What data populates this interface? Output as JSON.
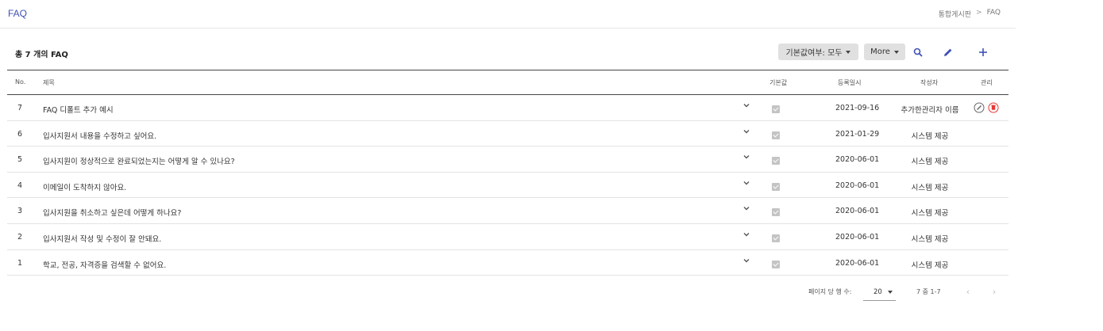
{
  "header": {
    "title": "FAQ",
    "breadcrumb": [
      "통합게시판",
      ">",
      "FAQ"
    ]
  },
  "toolbar": {
    "count_label": "총 7 개의 FAQ",
    "filter_label": "기본값여부: 모두",
    "more_label": "More",
    "icons": [
      "search-icon",
      "edit-icon",
      "add-icon"
    ]
  },
  "table": {
    "columns": {
      "no": "No.",
      "title": "제목",
      "default": "기본값",
      "date": "등록일시",
      "author": "작성자",
      "manage": "관리"
    },
    "rows": [
      {
        "no": "7",
        "title": "FAQ 디폴트 추가 예시",
        "default": true,
        "date": "2021-09-16",
        "author": "추가한관리자 이름",
        "manage": true
      },
      {
        "no": "6",
        "title": "입사지원서 내용을 수정하고 싶어요.",
        "default": true,
        "date": "2021-01-29",
        "author": "시스템 제공",
        "manage": false
      },
      {
        "no": "5",
        "title": "입사지원이 정상적으로 완료되었는지는 어떻게 알 수 있나요?",
        "default": true,
        "date": "2020-06-01",
        "author": "시스템 제공",
        "manage": false
      },
      {
        "no": "4",
        "title": "이메일이 도착하지 않아요.",
        "default": true,
        "date": "2020-06-01",
        "author": "시스템 제공",
        "manage": false
      },
      {
        "no": "3",
        "title": "입사지원을 취소하고 싶은데 어떻게 하나요?",
        "default": true,
        "date": "2020-06-01",
        "author": "시스템 제공",
        "manage": false
      },
      {
        "no": "2",
        "title": "입사지원서 작성 및 수정이 잘 안돼요.",
        "default": true,
        "date": "2020-06-01",
        "author": "시스템 제공",
        "manage": false
      },
      {
        "no": "1",
        "title": "학교, 전공, 자격증을 검색할 수 없어요.",
        "default": true,
        "date": "2020-06-01",
        "author": "시스템 제공",
        "manage": false
      }
    ]
  },
  "pagination": {
    "rows_per_page_label": "페이지 당 행 수:",
    "rows_per_page_value": "20",
    "range_label": "7 중 1-7"
  },
  "colors": {
    "accent": "#3f51b5",
    "delete": "#e53935"
  }
}
